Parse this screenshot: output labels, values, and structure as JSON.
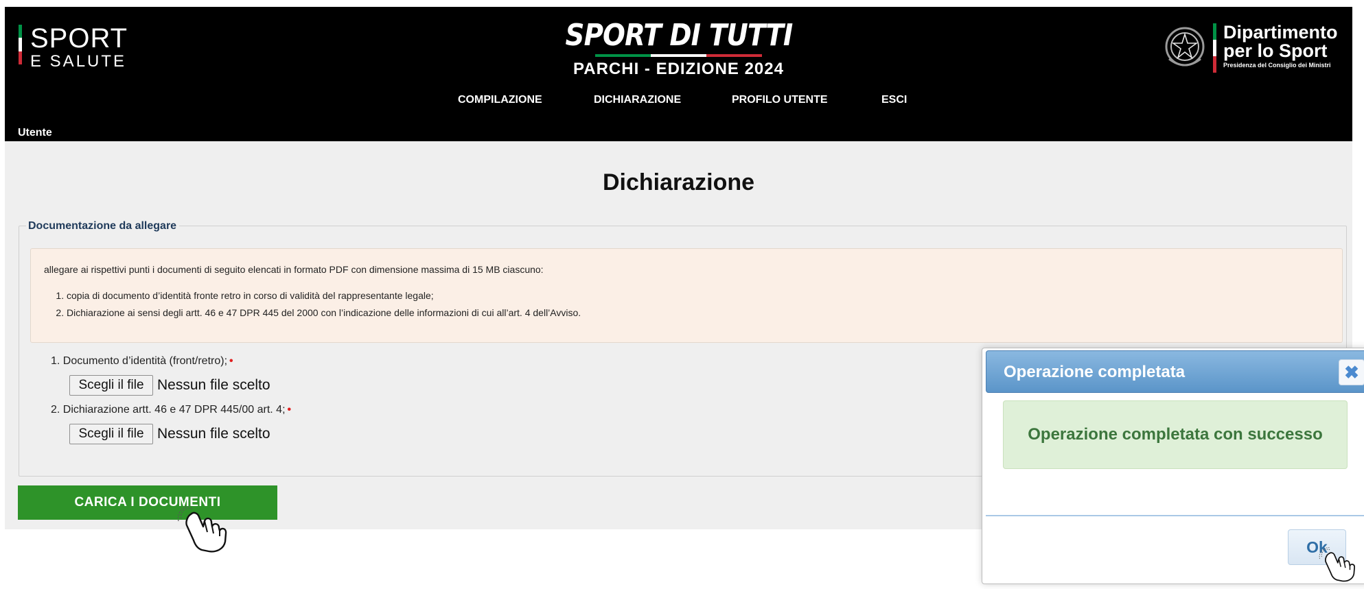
{
  "header": {
    "logo_left": {
      "line1": "SPORT",
      "line2": "E SALUTE"
    },
    "brand_title": "SPORT DI TUTTI",
    "brand_subtitle": "PARCHI - EDIZIONE 2024",
    "logo_right": {
      "line1": "Dipartimento",
      "line2": "per lo Sport",
      "line3": "Presidenza del Consiglio dei Ministri"
    },
    "nav": [
      "COMPILAZIONE",
      "DICHIARAZIONE",
      "PROFILO UTENTE",
      "ESCI"
    ],
    "user_label": "Utente"
  },
  "main": {
    "page_title": "Dichiarazione",
    "section_legend": "Documentazione da allegare",
    "info": {
      "intro": "allegare ai rispettivi punti i documenti di seguito elencati in formato PDF con dimensione massima di 15 MB ciascuno:",
      "items": [
        "copia di documento d’identità fronte retro in corso di validità del rappresentante legale;",
        "Dichiarazione ai sensi degli artt. 46 e 47 DPR 445 del 2000 con l’indicazione delle informazioni di cui all’art. 4 dell’Avviso."
      ]
    },
    "documents": [
      {
        "label": "1. Documento d’identità (front/retro);",
        "required_mark": "•",
        "button": "Scegli il file",
        "status": "Nessun file scelto"
      },
      {
        "label": "2. Dichiarazione artt. 46 e 47 DPR 445/00 art. 4;",
        "required_mark": "•",
        "button": "Scegli il file",
        "status": "Nessun file scelto"
      }
    ],
    "upload_button": "CARICA I DOCUMENTI"
  },
  "dialog": {
    "title": "Operazione completata",
    "close_glyph": "✖",
    "message": "Operazione completata con successo",
    "ok_label": "Ok"
  },
  "colors": {
    "header_bg": "#000000",
    "page_bg": "#efefef",
    "upload_button": "#2e9329",
    "info_bg": "#fbefe6",
    "dialog_titlebar": "#5b95c9",
    "success_bg": "#dff0d8",
    "success_text": "#3c763d"
  },
  "icons": [
    "pointer-hand-icon",
    "close-icon",
    "emblem-icon"
  ]
}
